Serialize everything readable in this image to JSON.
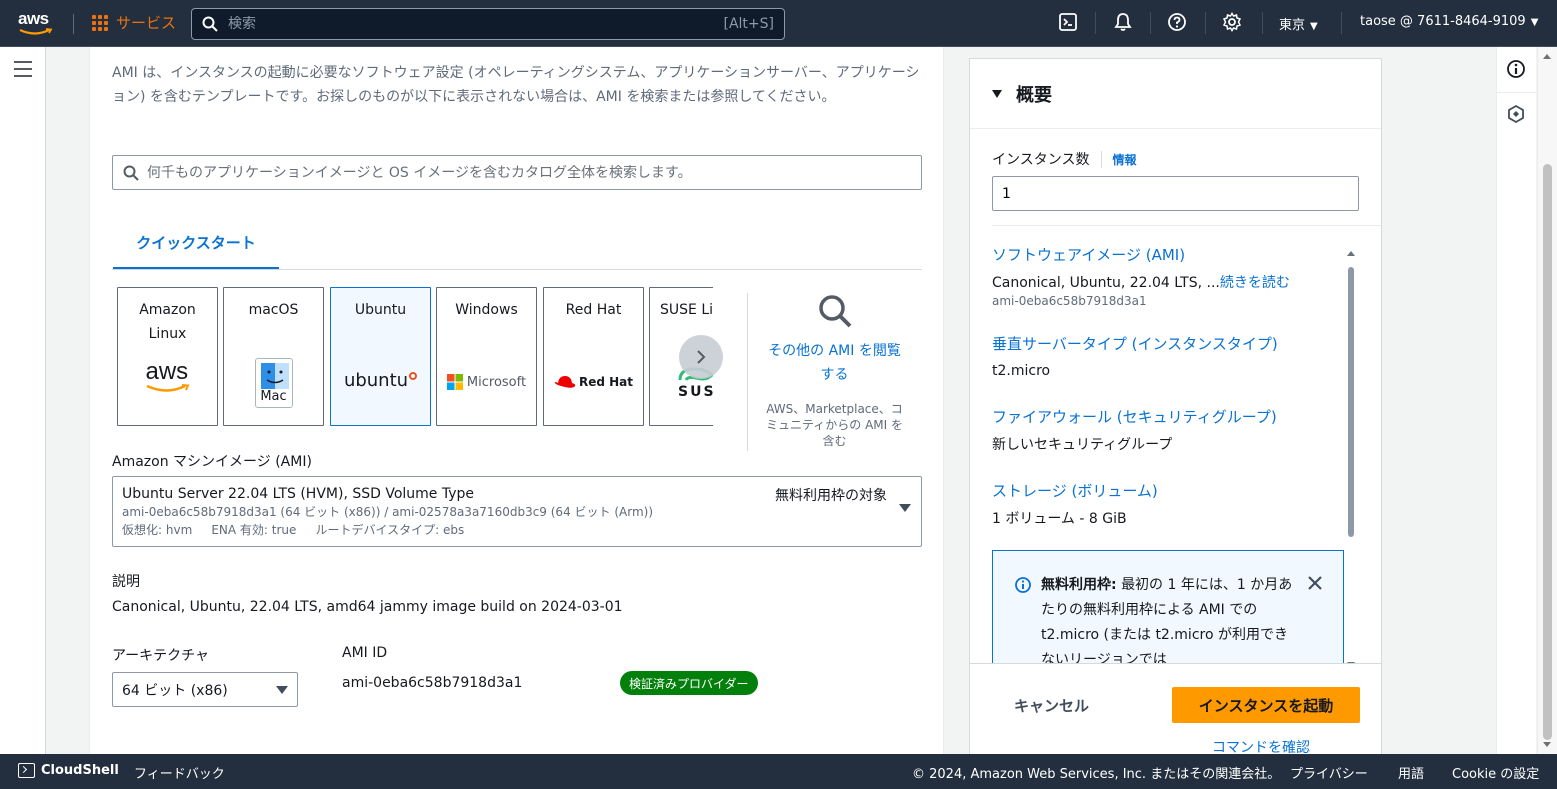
{
  "topnav": {
    "logo_text": "aws",
    "services_label": "サービス",
    "search_placeholder": "検索",
    "search_hint": "[Alt+S]",
    "region": "東京",
    "account": "taose @ 7611-8464-9109",
    "icons": [
      "cloudshell-icon",
      "bell-icon",
      "help-icon",
      "settings-icon"
    ]
  },
  "main": {
    "ami_description": "AMI は、インスタンスの起動に必要なソフトウェア設定 (オペレーティングシステム、アプリケーションサーバー、アプリケーション) を含むテンプレートです。お探しのものが以下に表示されない場合は、AMI を検索または参照してください。",
    "catalog_search_placeholder": "何千ものアプリケーションイメージと OS イメージを含むカタログ全体を検索します。",
    "tab_quickstart": "クイックスタート",
    "os_options": [
      {
        "name": "Amazon Linux",
        "logo": "aws"
      },
      {
        "name": "macOS",
        "logo": "Mac"
      },
      {
        "name": "Ubuntu",
        "logo": "ubuntu"
      },
      {
        "name": "Windows",
        "logo": "Microsoft"
      },
      {
        "name": "Red Hat",
        "logo": "Red Hat"
      },
      {
        "name": "SUSE Li",
        "logo": "SUS"
      }
    ],
    "selected_os": "Ubuntu",
    "browse_more_link": "その他の AMI を閲覧する",
    "browse_more_sub": "AWS、Marketplace、コミュニティからの AMI を含む",
    "ami_label": "Amazon マシンイメージ (AMI)",
    "ami_selected": {
      "name": "Ubuntu Server 22.04 LTS (HVM), SSD Volume Type",
      "ids": "ami-0eba6c58b7918d3a1 (64 ビット (x86)) / ami-02578a3a7160db3c9 (64 ビット (Arm))",
      "details": "仮想化: hvm     ENA 有効: true     ルートデバイスタイプ: ebs",
      "free_tier": "無料利用枠の対象"
    },
    "description_label": "説明",
    "description_value": "Canonical, Ubuntu, 22.04 LTS, amd64 jammy image build on 2024-03-01",
    "arch_label": "アーキテクチャ",
    "arch_value": "64 ビット (x86)",
    "ami_id_label": "AMI ID",
    "ami_id_value": "ami-0eba6c58b7918d3a1",
    "verified_badge": "検証済みプロバイダー"
  },
  "summary": {
    "title": "概要",
    "instance_count_label": "インスタンス数",
    "info_link": "情報",
    "instance_count_value": "1",
    "software_image_link": "ソフトウェアイメージ (AMI)",
    "software_image_value": "Canonical, Ubuntu, 22.04 LTS, ...",
    "read_more": "続きを読む",
    "software_image_id": "ami-0eba6c58b7918d3a1",
    "instance_type_link": "垂直サーバータイプ (インスタンスタイプ)",
    "instance_type_value": "t2.micro",
    "firewall_link": "ファイアウォール (セキュリティグループ)",
    "firewall_value": "新しいセキュリティグループ",
    "storage_link": "ストレージ (ボリューム)",
    "storage_value": "1 ボリューム - 8 GiB",
    "free_tier_title": "無料利用枠:",
    "free_tier_text": "最初の 1 年には、1 か月あたりの無料利用枠による AMI での t2.micro (または t2.micro が利用できないリージョンでは",
    "cancel_button": "キャンセル",
    "launch_button": "インスタンスを起動",
    "command_link": "コマンドを確認"
  },
  "footer": {
    "cloudshell": "CloudShell",
    "feedback": "フィードバック",
    "copyright": "© 2024, Amazon Web Services, Inc. またはその関連会社。",
    "privacy": "プライバシー",
    "terms": "用語",
    "cookie": "Cookie の設定"
  },
  "colors": {
    "nav_bg": "#232f3e",
    "accent_orange": "#ff9900",
    "link_blue": "#0972d3",
    "badge_green": "#037f0c"
  }
}
